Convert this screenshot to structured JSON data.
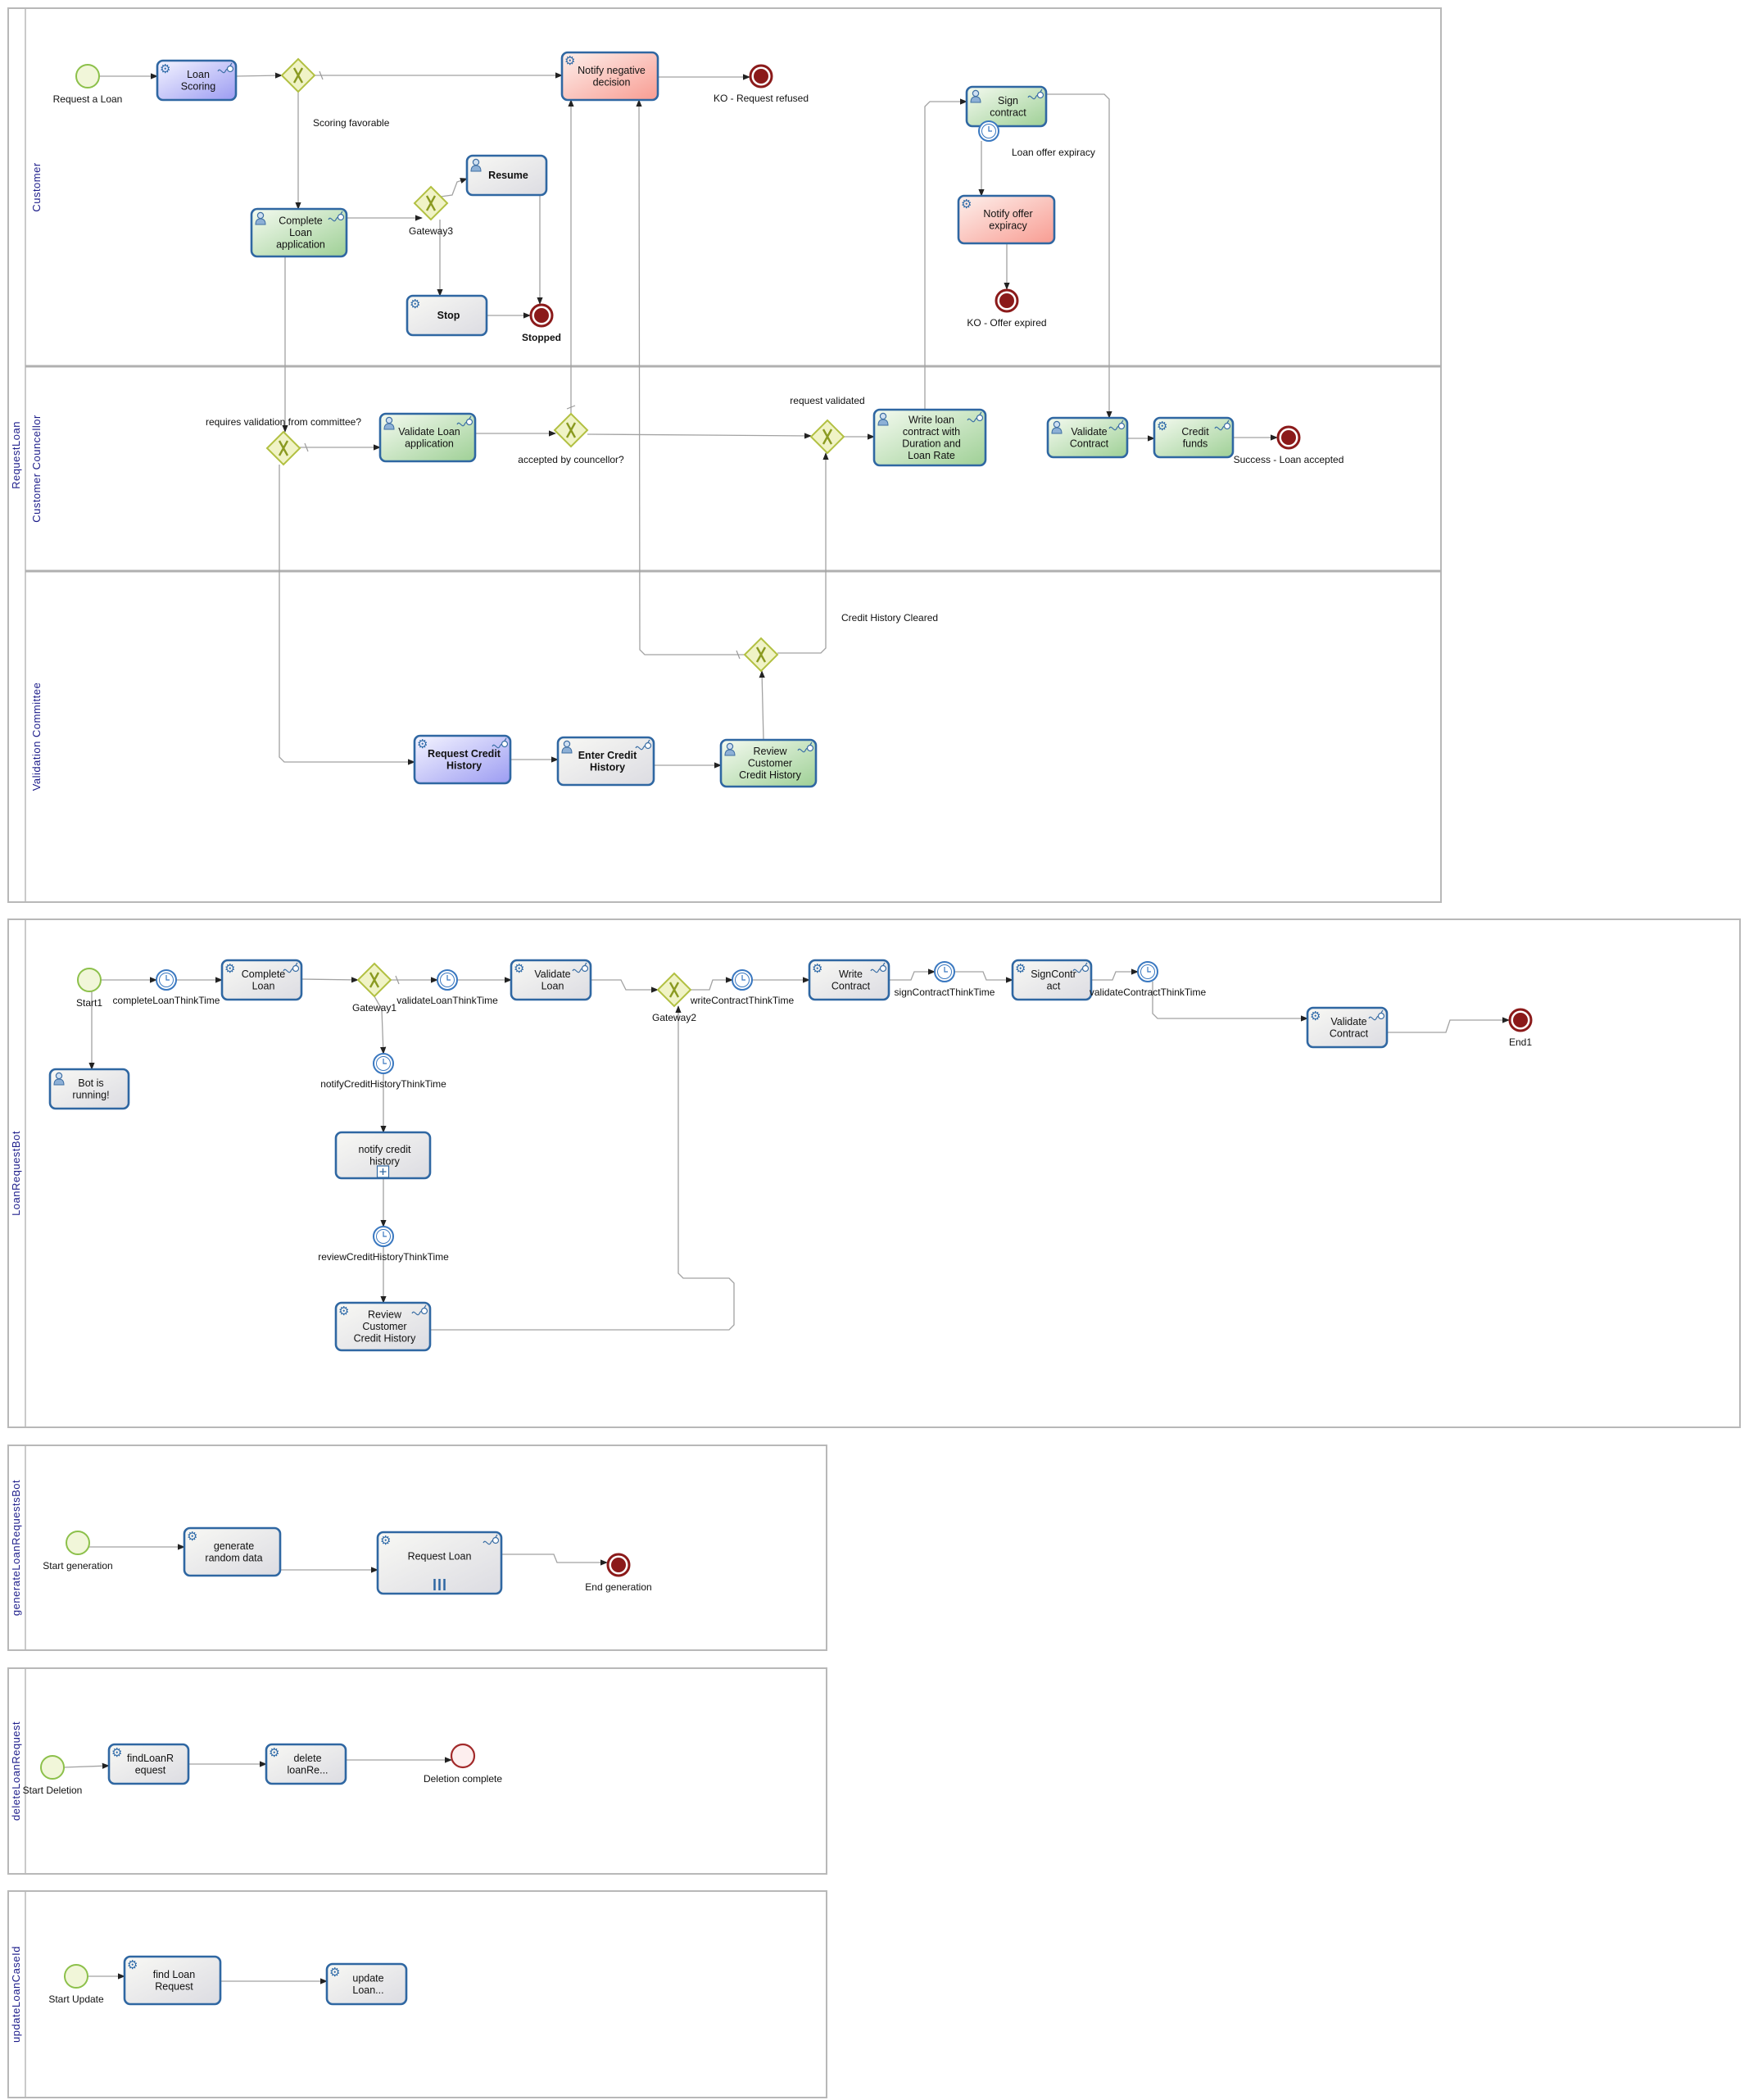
{
  "colors": {
    "task_border": "#2f67a2",
    "flow_line": "#a2a2a2",
    "pool_text": "#1c1c8a",
    "fill_purple": [
      "#f4f4ff",
      "#9c9cf2"
    ],
    "fill_green": [
      "#f4faf0",
      "#9fd096"
    ],
    "fill_red": [
      "#fdf0ec",
      "#f89c92"
    ],
    "fill_grey": [
      "#f8f8f4",
      "#dcdce2"
    ],
    "start_fill": "#f1f6d9",
    "start_stroke": "#8cc04a",
    "end_color": "#8b1a1a",
    "gateway_fill": "#f0f3c6",
    "gateway_stroke": "#b2c042",
    "timer_color": "#3a78c0"
  },
  "pools": [
    {
      "id": "requestloan",
      "name": "RequestLoan",
      "lanes": [
        "Customer",
        "Customer Councellor",
        "Validation Committee"
      ]
    },
    {
      "id": "bot",
      "name": "LoanRequestBot",
      "lanes": []
    },
    {
      "id": "generate",
      "name": "generateLoanRequestsBot",
      "lanes": []
    },
    {
      "id": "delete",
      "name": "deleteLoanRequest",
      "lanes": []
    },
    {
      "id": "update",
      "name": "updateLoanCaseId",
      "lanes": []
    }
  ],
  "nodes": [
    {
      "id": "start_req",
      "type": "start",
      "label": [
        "Request a Loan"
      ]
    },
    {
      "id": "loan_scoring",
      "type": "task",
      "icon": "gear",
      "connector": true,
      "fill": "purple",
      "label": [
        "Loan",
        "Scoring"
      ]
    },
    {
      "id": "gw_scoring",
      "type": "gateway",
      "label": []
    },
    {
      "id": "notify_neg",
      "type": "task",
      "icon": "gear",
      "connector": false,
      "fill": "red",
      "label": [
        "Notify negative",
        "decision"
      ]
    },
    {
      "id": "end_refused",
      "type": "end",
      "label": [
        "KO - Request refused"
      ]
    },
    {
      "id": "complete_app",
      "type": "task",
      "icon": "user",
      "connector": true,
      "fill": "green",
      "label": [
        "Complete",
        "Loan",
        "application"
      ]
    },
    {
      "id": "gw3",
      "type": "gateway",
      "label": [
        "Gateway3"
      ]
    },
    {
      "id": "resume",
      "type": "task",
      "icon": "user",
      "connector": false,
      "fill": "grey",
      "bold": true,
      "label": [
        "Resume"
      ]
    },
    {
      "id": "stop",
      "type": "task",
      "icon": "gear",
      "connector": false,
      "fill": "grey",
      "bold": true,
      "label": [
        "Stop"
      ]
    },
    {
      "id": "end_stopped",
      "type": "end",
      "bold": true,
      "label": [
        "Stopped"
      ]
    },
    {
      "id": "sign_contract",
      "type": "task",
      "icon": "user",
      "connector": true,
      "fill": "green",
      "label": [
        "Sign",
        "contract"
      ]
    },
    {
      "id": "timer_expiry",
      "type": "timer",
      "label": [
        "Loan offer expiracy"
      ]
    },
    {
      "id": "notify_offer",
      "type": "task",
      "icon": "gear",
      "connector": false,
      "fill": "red",
      "label": [
        "Notify offer",
        "expiracy"
      ]
    },
    {
      "id": "end_expired",
      "type": "end",
      "label": [
        "KO - Offer expired"
      ]
    },
    {
      "id": "gw_requires",
      "type": "gateway",
      "label": [
        "requires validation from committee?"
      ]
    },
    {
      "id": "validate_loan_app",
      "type": "task",
      "icon": "user",
      "connector": true,
      "fill": "green",
      "label": [
        "Validate Loan",
        "application"
      ]
    },
    {
      "id": "gw_accepted",
      "type": "gateway",
      "label": [
        "accepted by councellor?"
      ]
    },
    {
      "id": "gw_req_validated",
      "type": "gateway",
      "label": [
        "request validated"
      ]
    },
    {
      "id": "write_loan",
      "type": "task",
      "icon": "user",
      "connector": true,
      "fill": "green",
      "label": [
        "Write loan",
        "contract with",
        "Duration and",
        "Loan Rate"
      ]
    },
    {
      "id": "validate_contract",
      "type": "task",
      "icon": "user",
      "connector": true,
      "fill": "green",
      "label": [
        "Validate",
        "Contract"
      ]
    },
    {
      "id": "credit_funds",
      "type": "task",
      "icon": "gear",
      "connector": true,
      "fill": "green",
      "label": [
        "Credit",
        "funds"
      ]
    },
    {
      "id": "end_success",
      "type": "end",
      "label": [
        "Success - Loan accepted"
      ]
    },
    {
      "id": "request_credit",
      "type": "task",
      "icon": "gear",
      "connector": true,
      "fill": "purple",
      "bold": true,
      "label": [
        "Request Credit",
        "History"
      ]
    },
    {
      "id": "enter_credit",
      "type": "task",
      "icon": "user",
      "connector": true,
      "fill": "grey",
      "bold": true,
      "label": [
        "Enter Credit",
        "History"
      ]
    },
    {
      "id": "review_credit",
      "type": "task",
      "icon": "user",
      "connector": true,
      "fill": "green",
      "label": [
        "Review",
        "Customer",
        "Credit History"
      ]
    },
    {
      "id": "gw_credit",
      "type": "gateway",
      "label": [
        "Credit History Cleared"
      ]
    },
    {
      "id": "start1",
      "type": "start",
      "label": [
        "Start1"
      ]
    },
    {
      "id": "t_complete",
      "type": "timer",
      "label": [
        "completeLoanThinkTime"
      ]
    },
    {
      "id": "b_complete",
      "type": "task",
      "icon": "gear",
      "connector": true,
      "fill": "grey",
      "label": [
        "Complete",
        "Loan"
      ]
    },
    {
      "id": "gateway1",
      "type": "gateway",
      "label": [
        "Gateway1"
      ]
    },
    {
      "id": "t_validate",
      "type": "timer",
      "label": [
        "validateLoanThinkTime"
      ]
    },
    {
      "id": "b_validate",
      "type": "task",
      "icon": "gear",
      "connector": true,
      "fill": "grey",
      "label": [
        "Validate",
        "Loan"
      ]
    },
    {
      "id": "gateway2",
      "type": "gateway",
      "label": [
        "Gateway2"
      ]
    },
    {
      "id": "t_write",
      "type": "timer",
      "label": [
        "writeContractThinkTime"
      ]
    },
    {
      "id": "b_write",
      "type": "task",
      "icon": "gear",
      "connector": true,
      "fill": "grey",
      "label": [
        "Write",
        "Contract"
      ]
    },
    {
      "id": "t_sign",
      "type": "timer",
      "label": [
        "signContractThinkTime"
      ]
    },
    {
      "id": "b_sign",
      "type": "task",
      "icon": "gear",
      "connector": true,
      "fill": "grey",
      "label": [
        "SignContr",
        "act"
      ]
    },
    {
      "id": "t_valcontract",
      "type": "timer",
      "label": [
        "validateContractThinkTime"
      ]
    },
    {
      "id": "b_valcontract",
      "type": "task",
      "icon": "gear",
      "connector": true,
      "fill": "grey",
      "label": [
        "Validate",
        "Contract"
      ]
    },
    {
      "id": "end1",
      "type": "end",
      "label": [
        "End1"
      ]
    },
    {
      "id": "bot_running",
      "type": "task",
      "icon": "user",
      "connector": false,
      "fill": "grey",
      "label": [
        "Bot is",
        "running!"
      ]
    },
    {
      "id": "t_notify",
      "type": "timer",
      "label": [
        "notifyCreditHistoryThinkTime"
      ]
    },
    {
      "id": "sub_notify",
      "type": "subprocess",
      "icon": "",
      "connector": false,
      "fill": "grey",
      "label": [
        "notify credit",
        "history"
      ]
    },
    {
      "id": "t_review",
      "type": "timer",
      "label": [
        "reviewCreditHistoryThinkTime"
      ]
    },
    {
      "id": "b_review",
      "type": "task",
      "icon": "gear",
      "connector": true,
      "fill": "grey",
      "label": [
        "Review",
        "Customer",
        "Credit History"
      ]
    },
    {
      "id": "start_gen",
      "type": "start",
      "label": [
        "Start generation"
      ]
    },
    {
      "id": "gen_random",
      "type": "task",
      "icon": "gear",
      "connector": false,
      "fill": "grey",
      "label": [
        "generate",
        "random data"
      ]
    },
    {
      "id": "request_loan",
      "type": "multi",
      "icon": "gear",
      "connector": true,
      "fill": "grey",
      "label": [
        "Request Loan"
      ]
    },
    {
      "id": "end_gen",
      "type": "end",
      "label": [
        "End generation"
      ]
    },
    {
      "id": "start_del",
      "type": "start",
      "label": [
        "Start Deletion"
      ]
    },
    {
      "id": "find_loanr",
      "type": "task",
      "icon": "gear",
      "connector": false,
      "fill": "grey",
      "label": [
        "findLoanR",
        "equest"
      ]
    },
    {
      "id": "delete_loan",
      "type": "task",
      "icon": "gear",
      "connector": false,
      "fill": "grey",
      "label": [
        "delete",
        "loanRe..."
      ]
    },
    {
      "id": "end_del",
      "type": "end_light",
      "label": [
        "Deletion complete"
      ]
    },
    {
      "id": "start_upd",
      "type": "start",
      "label": [
        "Start Update"
      ]
    },
    {
      "id": "find_loan",
      "type": "task",
      "icon": "gear",
      "connector": false,
      "fill": "grey",
      "label": [
        "find Loan",
        "Request"
      ]
    },
    {
      "id": "update_loan",
      "type": "task",
      "icon": "gear",
      "connector": false,
      "fill": "grey",
      "label": [
        "update",
        "Loan..."
      ]
    }
  ],
  "flow_labels": [
    {
      "id": "scoring_favorable",
      "text": "Scoring favorable"
    }
  ]
}
